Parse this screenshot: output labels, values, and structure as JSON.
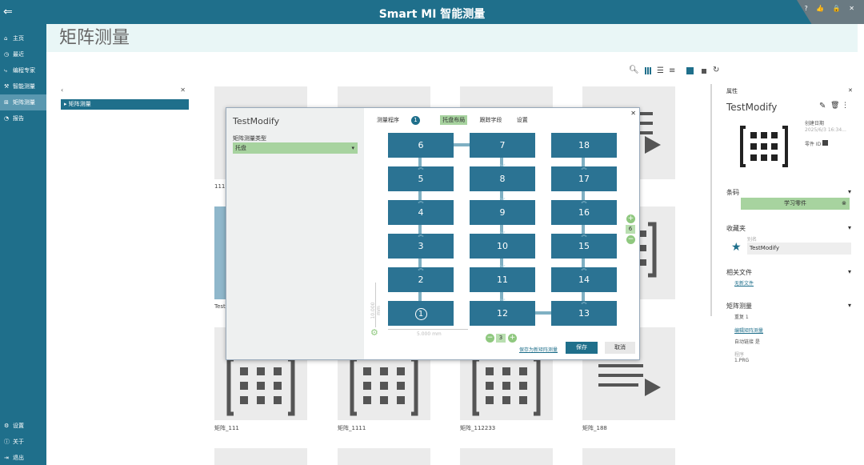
{
  "app": {
    "title": "Smart MI 智能测量",
    "back_icon": "arrow-left-icon",
    "corner_icons": "? 👍 🔒 ✕"
  },
  "sidebar": {
    "items": [
      {
        "label": "主页",
        "icon": "⌂"
      },
      {
        "label": "最近",
        "icon": "◷"
      },
      {
        "label": "编程专家",
        "icon": "⤷"
      },
      {
        "label": "智能测量",
        "icon": "⚒"
      },
      {
        "label": "矩阵测量",
        "icon": "⊞"
      },
      {
        "label": "报告",
        "icon": "◔"
      }
    ],
    "bottom": [
      {
        "label": "设置",
        "icon": "⚙"
      },
      {
        "label": "关于",
        "icon": "ⓘ"
      },
      {
        "label": "退出",
        "icon": "⇥"
      }
    ]
  },
  "page": {
    "title": "矩阵测量"
  },
  "toolbar": {
    "icons": [
      "search-icon",
      "grid-large-icon",
      "list-icon",
      "list-compact-icon",
      "square-filled-icon",
      "square-small-icon",
      "refresh-icon"
    ]
  },
  "tree": {
    "back": "‹",
    "close": "✕",
    "node": "▸ 矩阵测量"
  },
  "tiles": {
    "labels": [
      "111",
      "Test",
      "矩阵_111",
      "矩阵_1111",
      "矩阵_112233",
      "矩阵_188"
    ]
  },
  "dialog": {
    "name": "TestModify",
    "type_label": "矩阵测量类型",
    "type_value": "托盘",
    "tabs": {
      "program": "测量程序",
      "badge": "1",
      "layout": "托盘布局",
      "path": "跟踪字段",
      "settings": "设置"
    },
    "close": "✕",
    "cells": [
      "6",
      "5",
      "4",
      "3",
      "2",
      "1",
      "7",
      "8",
      "9",
      "10",
      "11",
      "12",
      "18",
      "17",
      "16",
      "15",
      "14",
      "13"
    ],
    "y_dim": "10.000 mm",
    "x_dim": "5.000 mm",
    "rows_value": "6",
    "cols_value": "3",
    "save_as": "保存为新矩阵测量",
    "save": "保存",
    "cancel": "取消"
  },
  "props": {
    "header": "属性",
    "close": "✕",
    "title": "TestModify",
    "created_label": "创建日期",
    "created_value": "2025/6/3 16:34...",
    "part_id_label": "零件 ID",
    "barcode_section": "条码",
    "barcode_value": "学习零件",
    "favorites_section": "收藏夹",
    "alias_label": "别名",
    "alias_value": "TestModify",
    "files_section": "相关文件",
    "files_link": "无新文件",
    "matrix_section": "矩阵测量",
    "repeat": "重复 1",
    "edit_link": "编辑矩阵测量",
    "auto_link": "自动链接 是",
    "program_label": "程序",
    "program_value": "1.PRG"
  }
}
